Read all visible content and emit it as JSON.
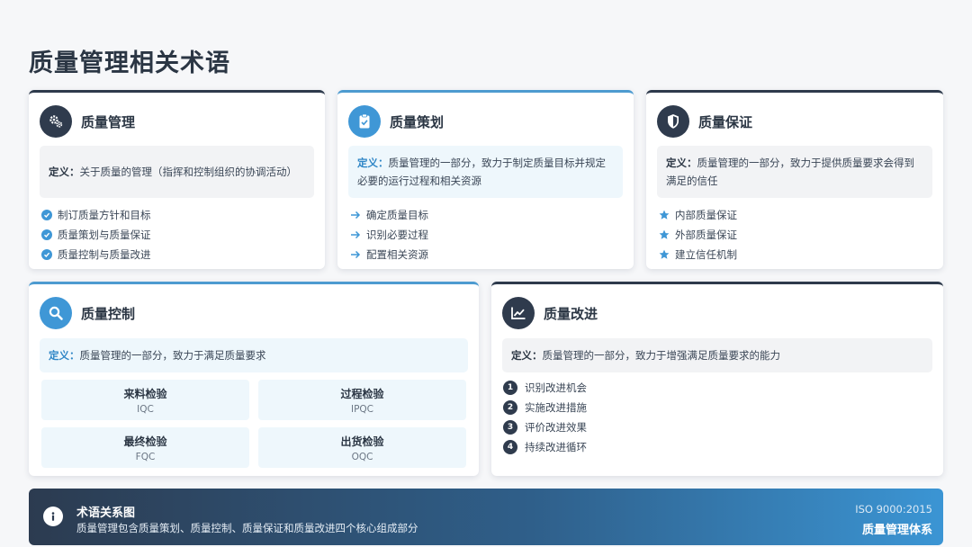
{
  "page": {
    "title": "质量管理相关术语"
  },
  "cards": {
    "qm": {
      "title": "质量管理",
      "def_label": "定义：",
      "def_text": "关于质量的管理（指挥和控制组织的协调活动）",
      "items": [
        "制订质量方针和目标",
        "质量策划与质量保证",
        "质量控制与质量改进"
      ],
      "icon": "gears-icon"
    },
    "qp": {
      "title": "质量策划",
      "def_label": "定义：",
      "def_text": "质量管理的一部分，致力于制定质量目标并规定必要的运行过程和相关资源",
      "items": [
        "确定质量目标",
        "识别必要过程",
        "配置相关资源"
      ],
      "icon": "clipboard-check-icon"
    },
    "qa": {
      "title": "质量保证",
      "def_label": "定义：",
      "def_text": "质量管理的一部分，致力于提供质量要求会得到满足的信任",
      "items": [
        "内部质量保证",
        "外部质量保证",
        "建立信任机制"
      ],
      "icon": "shield-icon"
    },
    "qc": {
      "title": "质量控制",
      "def_label": "定义：",
      "def_text": "质量管理的一部分，致力于满足质量要求",
      "inspections": [
        {
          "name": "来料检验",
          "code": "IQC"
        },
        {
          "name": "过程检验",
          "code": "IPQC"
        },
        {
          "name": "最终检验",
          "code": "FQC"
        },
        {
          "name": "出货检验",
          "code": "OQC"
        }
      ],
      "icon": "search-icon"
    },
    "qi": {
      "title": "质量改进",
      "def_label": "定义：",
      "def_text": "质量管理的一部分，致力于增强满足质量要求的能力",
      "steps": [
        {
          "num": "1",
          "text": "识别改进机会"
        },
        {
          "num": "2",
          "text": "实施改进措施"
        },
        {
          "num": "3",
          "text": "评价改进效果"
        },
        {
          "num": "4",
          "text": "持续改进循环"
        }
      ],
      "icon": "chart-line-icon"
    }
  },
  "footer": {
    "title": "术语关系图",
    "desc": "质量管理包含质量策划、质量控制、质量保证和质量改进四个核心组成部分",
    "standard": "ISO 9000:2015",
    "system": "质量管理体系",
    "icon": "info-icon"
  },
  "colors": {
    "dark": "#2f3b4d",
    "blue": "#3f97d6"
  }
}
